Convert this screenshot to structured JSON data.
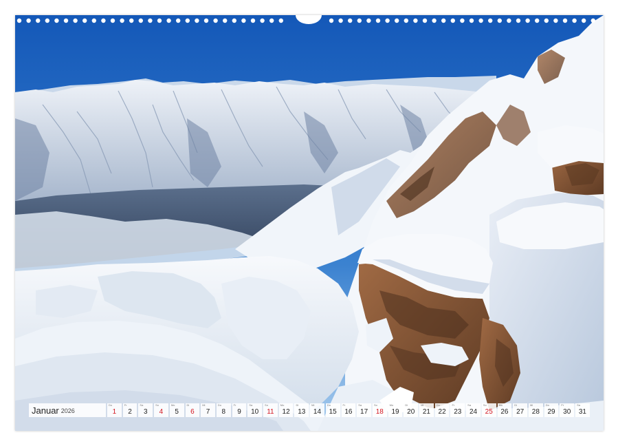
{
  "calendar": {
    "month": "Januar",
    "year": "2026",
    "days": [
      {
        "wd": "Do",
        "num": "1",
        "red": true
      },
      {
        "wd": "Fr",
        "num": "2",
        "red": false
      },
      {
        "wd": "Sa",
        "num": "3",
        "red": false
      },
      {
        "wd": "So",
        "num": "4",
        "red": true
      },
      {
        "wd": "Mo",
        "num": "5",
        "red": false
      },
      {
        "wd": "Di",
        "num": "6",
        "red": true
      },
      {
        "wd": "Mi",
        "num": "7",
        "red": false
      },
      {
        "wd": "Do",
        "num": "8",
        "red": false
      },
      {
        "wd": "Fr",
        "num": "9",
        "red": false
      },
      {
        "wd": "Sa",
        "num": "10",
        "red": false
      },
      {
        "wd": "So",
        "num": "11",
        "red": true
      },
      {
        "wd": "Mo",
        "num": "12",
        "red": false
      },
      {
        "wd": "Di",
        "num": "13",
        "red": false
      },
      {
        "wd": "Mi",
        "num": "14",
        "red": false
      },
      {
        "wd": "Do",
        "num": "15",
        "red": false
      },
      {
        "wd": "Fr",
        "num": "16",
        "red": false
      },
      {
        "wd": "Sa",
        "num": "17",
        "red": false
      },
      {
        "wd": "So",
        "num": "18",
        "red": true
      },
      {
        "wd": "Mo",
        "num": "19",
        "red": false
      },
      {
        "wd": "Di",
        "num": "20",
        "red": false
      },
      {
        "wd": "Mi",
        "num": "21",
        "red": false
      },
      {
        "wd": "Do",
        "num": "22",
        "red": false
      },
      {
        "wd": "Fr",
        "num": "23",
        "red": false
      },
      {
        "wd": "Sa",
        "num": "24",
        "red": false
      },
      {
        "wd": "So",
        "num": "25",
        "red": true
      },
      {
        "wd": "Mo",
        "num": "26",
        "red": false
      },
      {
        "wd": "Di",
        "num": "27",
        "red": false
      },
      {
        "wd": "Mi",
        "num": "28",
        "red": false
      },
      {
        "wd": "Do",
        "num": "29",
        "red": false
      },
      {
        "wd": "Fr",
        "num": "30",
        "red": false
      },
      {
        "wd": "Sa",
        "num": "31",
        "red": false
      }
    ]
  },
  "colors": {
    "sky_top": "#1a63c2",
    "sky_bottom": "#8fc0ea",
    "snow": "#f3f6fa",
    "rock": "#8a5a3a",
    "holiday": "#d2141e"
  }
}
